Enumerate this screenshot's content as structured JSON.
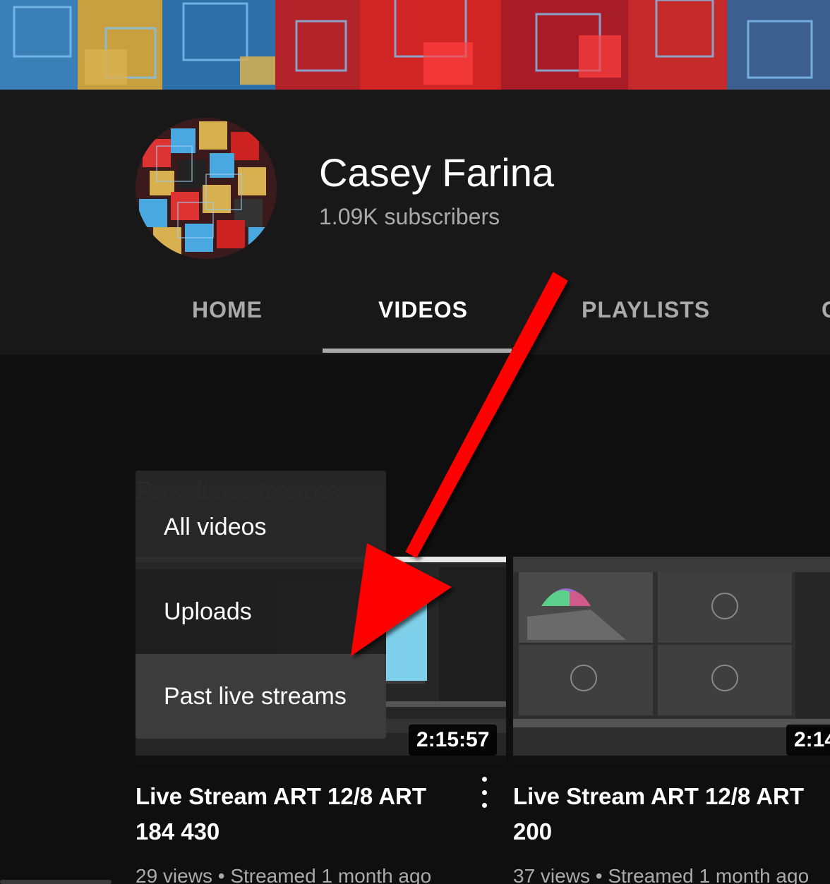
{
  "channel": {
    "name": "Casey Farina",
    "subscribers": "1.09K subscribers"
  },
  "tabs": [
    {
      "label": "HOME",
      "active": false
    },
    {
      "label": "VIDEOS",
      "active": true
    },
    {
      "label": "PLAYLISTS",
      "active": false
    }
  ],
  "sort": {
    "selected_label": "Past live streams",
    "options": [
      "All videos",
      "Uploads",
      "Past live streams"
    ],
    "highlighted": "Past live streams"
  },
  "videos": [
    {
      "title_line1": "Live Stream ART 12/8 ART",
      "title_line2": "184 430",
      "duration": "2:15:57",
      "views": "29 views",
      "age": "Streamed 1 month ago"
    },
    {
      "title_line1": "Live Stream ART 12/8 ART",
      "title_line2": "200",
      "duration": "2:14",
      "views": "37 views",
      "age": "Streamed 1 month ago"
    }
  ],
  "meta_separator": "•",
  "annotation": {
    "color": "#ff0000",
    "type": "red-arrow"
  }
}
